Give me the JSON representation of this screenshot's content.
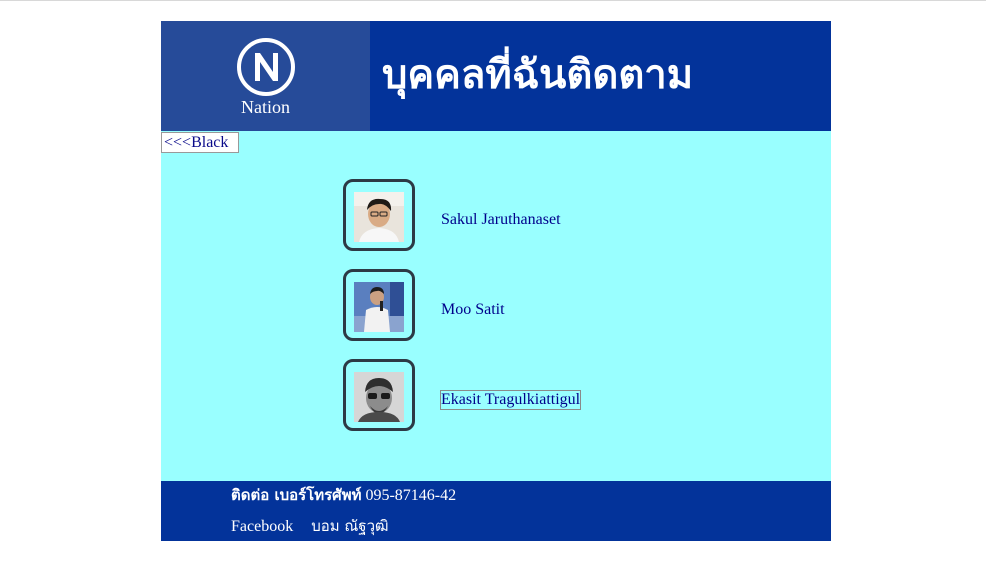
{
  "header": {
    "logo_text": "Nation",
    "title": "บุคคลที่ฉันติดตาม"
  },
  "nav": {
    "back_label": "<<<Black"
  },
  "following": [
    {
      "name": "Sakul Jaruthanaset"
    },
    {
      "name": "Moo Satit"
    },
    {
      "name": "Ekasit Tragulkiattigul"
    }
  ],
  "footer": {
    "contact_label": "ติดต่อ เบอร์โทรศัพท์",
    "phone": "095-87146-42",
    "social_label": "Facebook",
    "social_owner": "บอม ณัฐวุฒิ"
  },
  "colors": {
    "header_bg": "#03339a",
    "logo_bg": "#264b99",
    "content_bg": "#99ffff",
    "link": "#00008b"
  }
}
